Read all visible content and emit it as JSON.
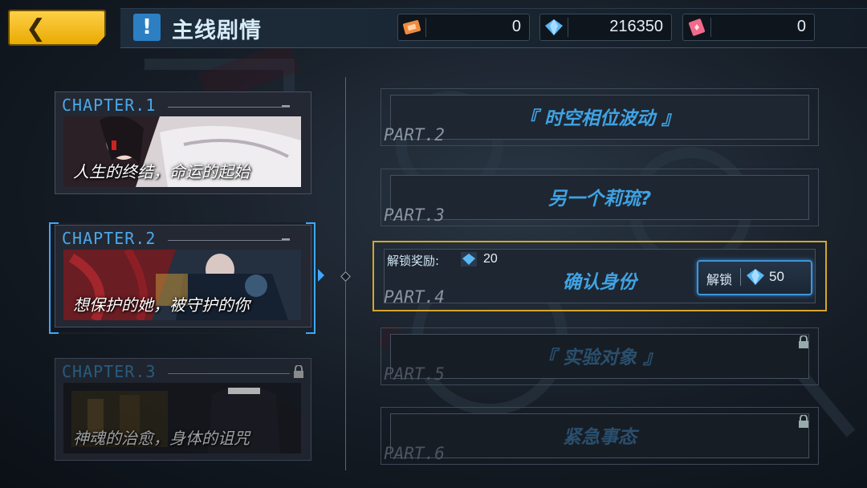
{
  "header": {
    "title": "主线剧情",
    "resources": [
      {
        "icon": "orange-ticket-icon",
        "value": "0"
      },
      {
        "icon": "blue-crystal-icon",
        "value": "216350"
      },
      {
        "icon": "pink-card-icon",
        "value": "0"
      }
    ]
  },
  "chapters": [
    {
      "label": "CHAPTER.1",
      "name": "人生的终结，命运的起始",
      "locked": false,
      "selected": false
    },
    {
      "label": "CHAPTER.2",
      "name": "想保护的她，被守护的你",
      "locked": false,
      "selected": true
    },
    {
      "label": "CHAPTER.3",
      "name": "神魂的治愈，身体的诅咒",
      "locked": true,
      "selected": false
    }
  ],
  "parts": [
    {
      "label": "PART.2",
      "name": "『 时空相位波动 』",
      "state": "cleared"
    },
    {
      "label": "PART.3",
      "name": "另一个莉琉?",
      "state": "cleared"
    },
    {
      "label": "PART.4",
      "name": "确认身份",
      "state": "unlockable",
      "reward_label": "解锁奖励:",
      "reward_value": "20",
      "unlock_label": "解锁",
      "unlock_cost": "50"
    },
    {
      "label": "PART.5",
      "name": "『 实验对象 』",
      "state": "locked"
    },
    {
      "label": "PART.6",
      "name": "紧急事态",
      "state": "locked"
    }
  ],
  "colors": {
    "accent": "#3fa7ff",
    "highlight": "#d6a52a",
    "back_button": "#f5c020"
  }
}
